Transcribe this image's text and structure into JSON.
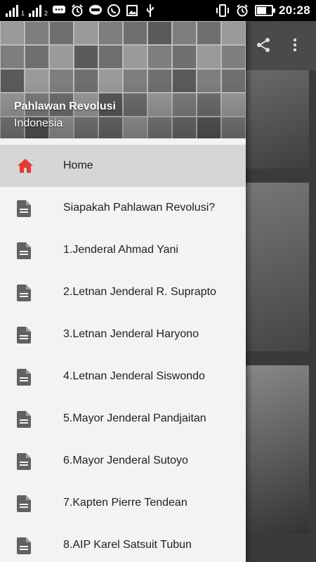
{
  "status_bar": {
    "time": "20:28",
    "sim1_label": "1",
    "sim2_label": "2",
    "icons": [
      "signal-icon",
      "signal-icon",
      "chat-icon",
      "alarm-icon",
      "line-icon",
      "whatsapp-icon",
      "image-icon",
      "usb-icon",
      "vibrate-icon",
      "alarm-icon",
      "battery-charging-icon"
    ]
  },
  "app_bar": {
    "actions": [
      "share-icon",
      "more-vert-icon"
    ]
  },
  "drawer": {
    "header": {
      "title": "Pahlawan Revolusi",
      "subtitle": "Indonesia"
    },
    "items": [
      {
        "label": "Home",
        "icon": "home-icon",
        "active": true,
        "color": "#e53935"
      },
      {
        "label": "Siapakah Pahlawan Revolusi?",
        "icon": "document-icon"
      },
      {
        "label": "1.Jenderal Ahmad Yani",
        "icon": "document-icon"
      },
      {
        "label": "2.Letnan Jenderal R. Suprapto",
        "icon": "document-icon"
      },
      {
        "label": "3.Letnan Jenderal Haryono",
        "icon": "document-icon"
      },
      {
        "label": "4.Letnan Jenderal Siswondo",
        "icon": "document-icon"
      },
      {
        "label": "5.Mayor Jenderal Pandjaitan",
        "icon": "document-icon"
      },
      {
        "label": "6.Mayor Jenderal Sutoyo",
        "icon": "document-icon"
      },
      {
        "label": "7.Kapten Pierre Tendean",
        "icon": "document-icon"
      },
      {
        "label": "8.AIP Karel Satsuit Tubun",
        "icon": "document-icon"
      }
    ]
  }
}
